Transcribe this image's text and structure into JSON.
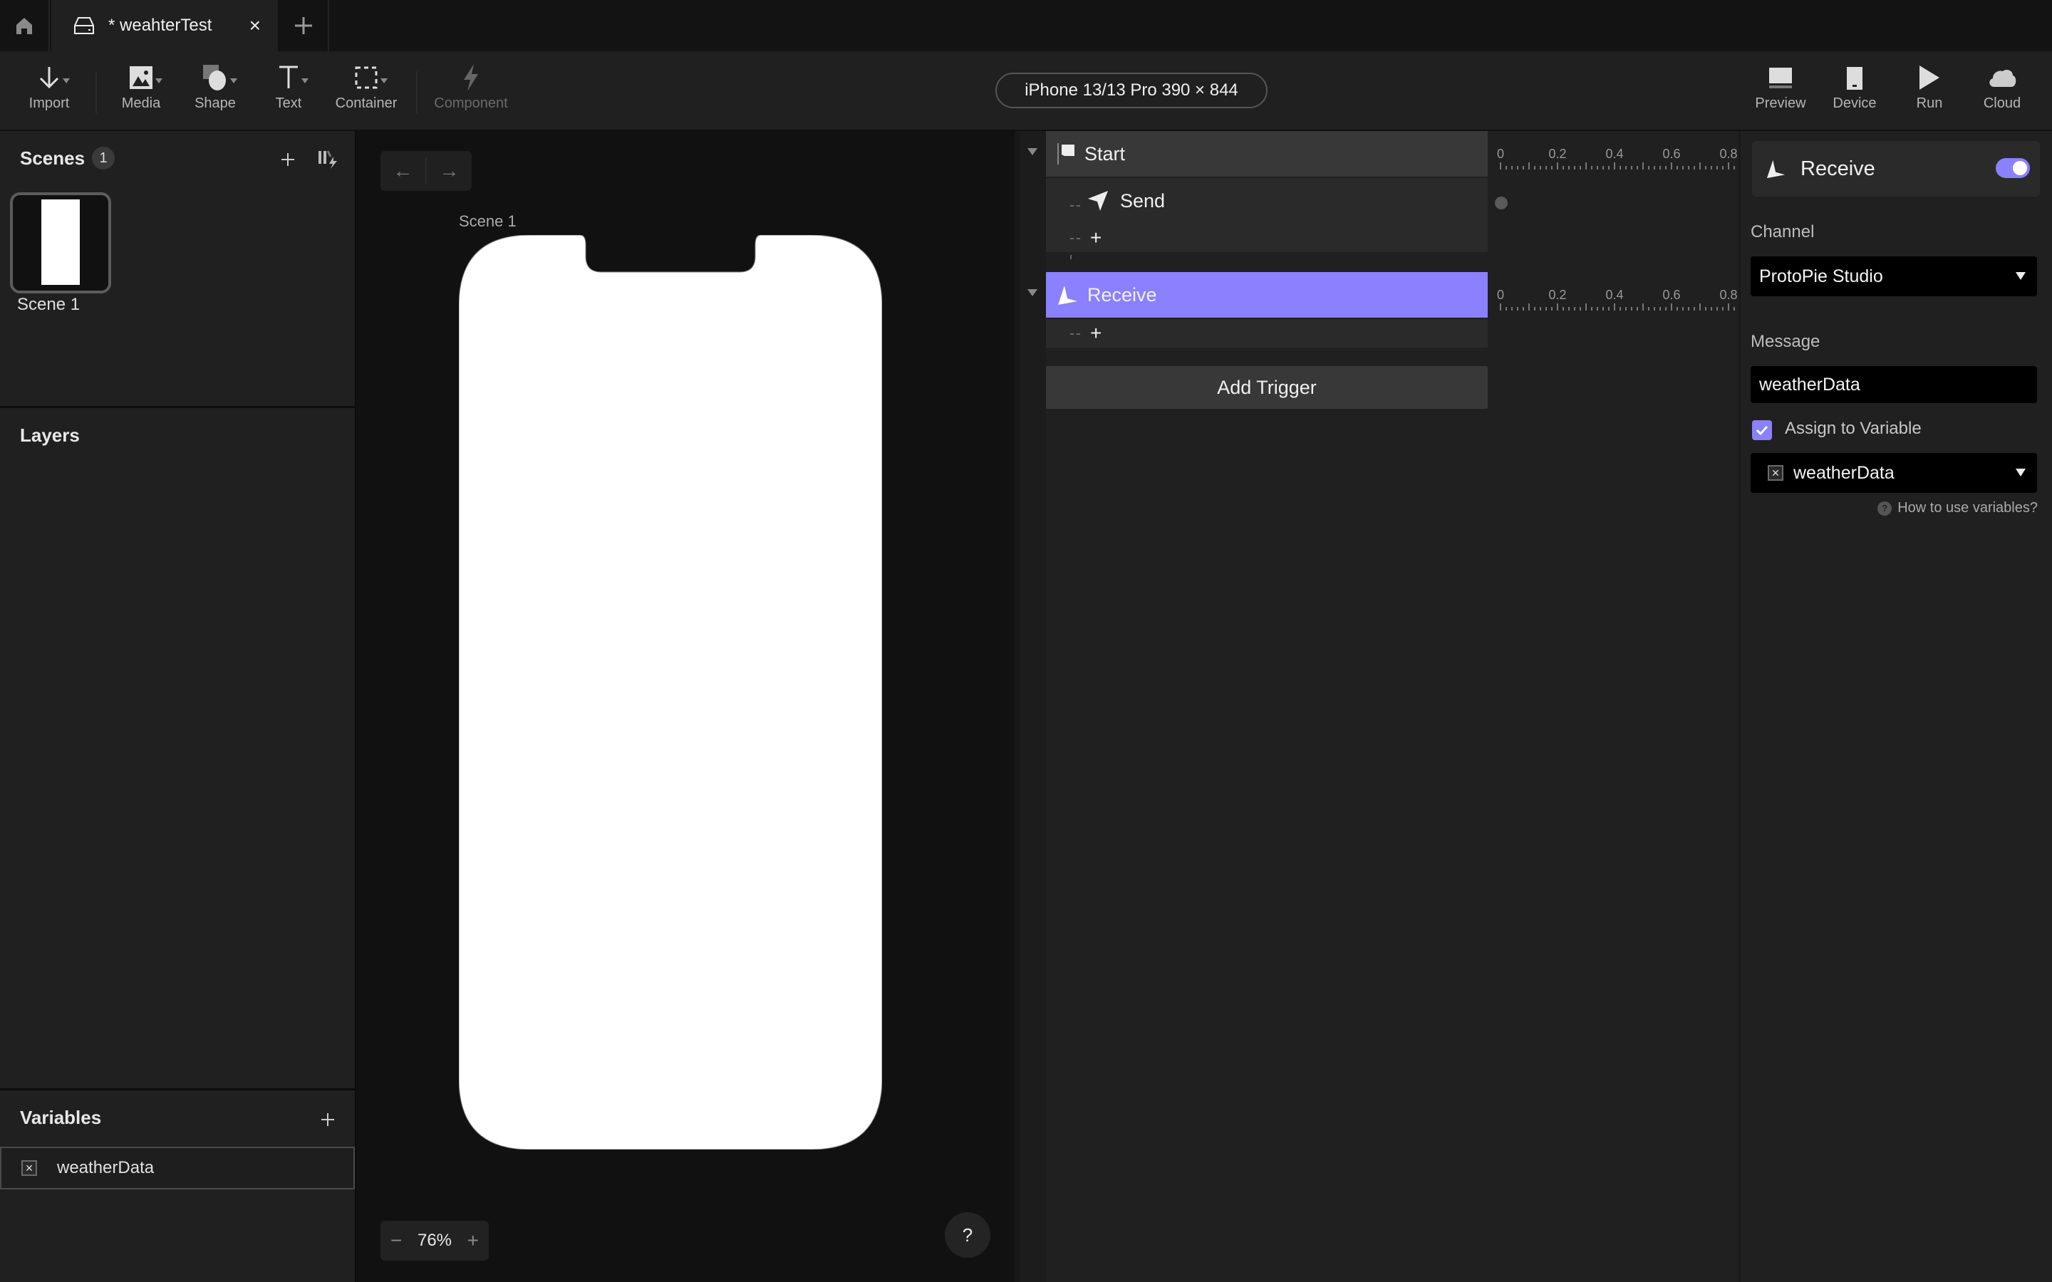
{
  "tabbar": {
    "home_icon": "home-icon",
    "tab": {
      "icon": "drive-icon",
      "title": "* weahterTest",
      "close": "×"
    },
    "new_tab": "+"
  },
  "toolbar": {
    "tools": [
      {
        "label": "Import",
        "icon": "import-arrow-icon"
      },
      {
        "label": "Media",
        "icon": "image-icon"
      },
      {
        "label": "Shape",
        "icon": "shape-icon"
      },
      {
        "label": "Text",
        "icon": "text-icon"
      },
      {
        "label": "Container",
        "icon": "container-icon"
      },
      {
        "label": "Component",
        "icon": "lightning-icon",
        "disabled": true
      }
    ],
    "device": "iPhone 13/13 Pro  390 × 844",
    "right_tools": [
      {
        "label": "Preview",
        "icon": "preview-icon"
      },
      {
        "label": "Device",
        "icon": "device-icon"
      },
      {
        "label": "Run",
        "icon": "play-icon"
      },
      {
        "label": "Cloud",
        "icon": "cloud-icon"
      }
    ]
  },
  "left_panel": {
    "scenes": {
      "title": "Scenes",
      "count": "1",
      "items": [
        {
          "label": "Scene 1"
        }
      ]
    },
    "layers": {
      "title": "Layers"
    },
    "variables": {
      "title": "Variables",
      "items": [
        {
          "name": "weatherData"
        }
      ]
    }
  },
  "canvas": {
    "nav_back": "←",
    "nav_forward": "→",
    "scene_name": "Scene 1",
    "zoom_minus": "−",
    "zoom_level": "76%",
    "zoom_plus": "+",
    "help": "?"
  },
  "interactions": {
    "triggers": [
      {
        "label": "Start",
        "icon": "flag-icon",
        "selected": false,
        "responses": [
          {
            "label": "Send",
            "icon": "send-icon"
          }
        ]
      },
      {
        "label": "Receive",
        "icon": "receive-icon",
        "selected": true,
        "responses": []
      }
    ],
    "add_response": "+",
    "add_trigger": "Add Trigger"
  },
  "timeline": {
    "ticks": [
      "0",
      "0.2",
      "0.4",
      "0.6",
      "0.8"
    ]
  },
  "properties": {
    "title": "Receive",
    "enabled": true,
    "channel_label": "Channel",
    "channel_value": "ProtoPie Studio",
    "message_label": "Message",
    "message_value": "weatherData",
    "assign_label": "Assign to Variable",
    "assign_checked": true,
    "variable_value": "weatherData",
    "help_link": "How to use variables?",
    "accent_color": "#8b80fd"
  }
}
